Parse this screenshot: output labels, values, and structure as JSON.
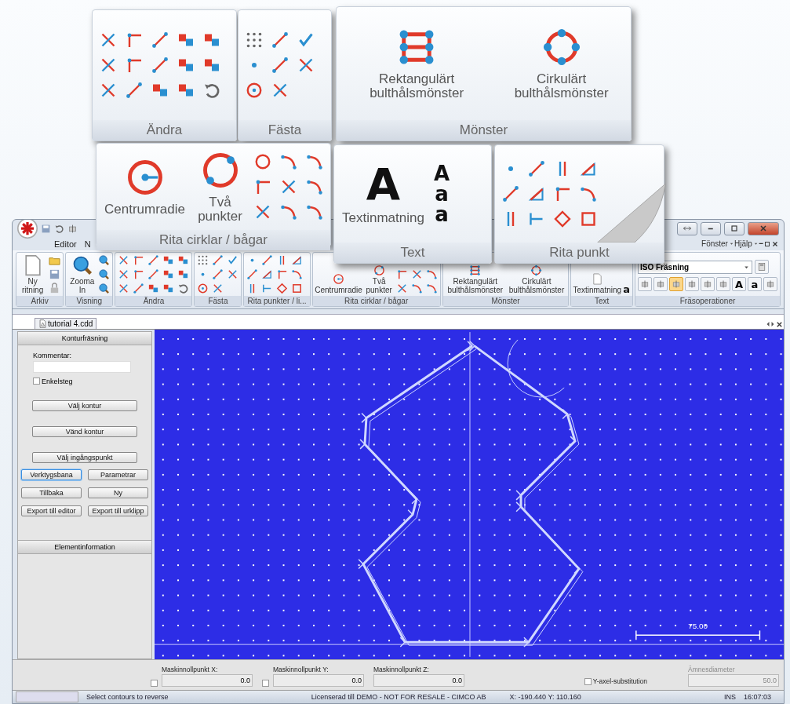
{
  "callouts": [
    {
      "kind": "edit",
      "label": "Ändra"
    },
    {
      "kind": "snap",
      "label": "Fästa"
    },
    {
      "kind": "pattern",
      "label": "Mönster",
      "buttons": [
        {
          "label": "Rektangulärt bulthålsmönster"
        },
        {
          "label": "Cirkulärt bulthålsmönster"
        }
      ]
    },
    {
      "kind": "arcs",
      "label": "Rita cirklar / bågar",
      "buttons": [
        {
          "label": "Centrumradie"
        },
        {
          "label": "Två punkter"
        }
      ]
    },
    {
      "kind": "text",
      "label": "Text",
      "buttons": [
        {
          "label": "Textinmatning",
          "glyph": "A"
        }
      ],
      "glyphs": [
        "A",
        "a",
        "a"
      ]
    },
    {
      "kind": "points",
      "label": "Rita punkt"
    }
  ],
  "window": {
    "menu_tabs": [
      {
        "label": "Editor"
      },
      {
        "label": "N"
      }
    ],
    "menu_right": [
      {
        "label": "Fönster"
      },
      {
        "label": "Hjälp"
      }
    ],
    "ribbon": [
      {
        "kind": "file",
        "label": "Arkiv",
        "buttons": [
          {
            "label": "Ny ritning"
          }
        ]
      },
      {
        "kind": "view",
        "label": "Visning",
        "buttons": [
          {
            "label": "Zooma In"
          }
        ]
      },
      {
        "kind": "edit",
        "label": "Ändra"
      },
      {
        "kind": "snap",
        "label": "Fästa"
      },
      {
        "kind": "points",
        "label": "Rita punkter / li..."
      },
      {
        "kind": "arcs",
        "label": "Rita cirklar / bågar",
        "buttons": [
          {
            "label": "Centrumradie"
          },
          {
            "label": "Två punkter"
          }
        ]
      },
      {
        "kind": "pattern",
        "label": "Mönster",
        "buttons": [
          {
            "label": "Rektangulärt bulthålsmönster"
          },
          {
            "label": "Cirkulärt bulthålsmönster"
          }
        ]
      },
      {
        "kind": "text",
        "label": "Text",
        "buttons": [
          {
            "label": "Textinmatning"
          }
        ],
        "glyphs": [
          "a"
        ]
      },
      {
        "kind": "milling",
        "label": "Fräsoperationer",
        "dropdown": "ISO Fräsning",
        "tools": [
          {
            "kind": "icon",
            "selected": false
          },
          {
            "kind": "icon",
            "selected": false
          },
          {
            "kind": "icon",
            "selected": true
          },
          {
            "kind": "icon",
            "selected": false
          },
          {
            "kind": "icon",
            "selected": false
          },
          {
            "kind": "icon",
            "selected": false
          },
          {
            "kind": "glyph",
            "text": "A",
            "selected": false
          },
          {
            "kind": "glyph",
            "text": "a",
            "selected": false
          },
          {
            "kind": "icon",
            "selected": false
          }
        ]
      }
    ],
    "document_tab": "tutorial 4.cdd",
    "panel": {
      "title": "Konturfräsning",
      "comment_label": "Kommentar:",
      "single_step": {
        "label": "Enkelsteg",
        "checked": false
      },
      "wide_buttons": [
        {
          "label": "Välj kontur"
        },
        {
          "label": "Vänd kontur"
        },
        {
          "label": "Välj ingångspunkt"
        }
      ],
      "pair_buttons": [
        {
          "label": "Verktygsbana",
          "selected": true
        },
        {
          "label": "Parametrar",
          "selected": false
        },
        {
          "label": "Tillbaka",
          "selected": false
        },
        {
          "label": "Ny",
          "selected": false
        },
        {
          "label": "Export till editor",
          "selected": false
        },
        {
          "label": "Export till urklipp",
          "selected": false
        }
      ],
      "info_title": "Elementinformation"
    },
    "canvas": {
      "scale_label": "75.00"
    },
    "fields": [
      {
        "label": "Maskinnollpunkt X:",
        "value": "0.0",
        "checked": false
      },
      {
        "label": "Maskinnollpunkt Y:",
        "value": "0.0",
        "checked": false
      },
      {
        "label": "Maskinnollpunkt Z:",
        "value": "0.0"
      }
    ],
    "y_substitution": {
      "label": "Y-axel-substitution",
      "checked": false
    },
    "diameter": {
      "label": "Ämnesdiameter",
      "value": "50.0",
      "disabled": true
    },
    "status_bar": {
      "message": "Select contours to reverse",
      "license": "Licenserad till DEMO - NOT FOR RESALE - CIMCO AB",
      "coordinates": "X: -190.440 Y: 110.160",
      "mode": "INS",
      "time": "16:07:03"
    }
  }
}
